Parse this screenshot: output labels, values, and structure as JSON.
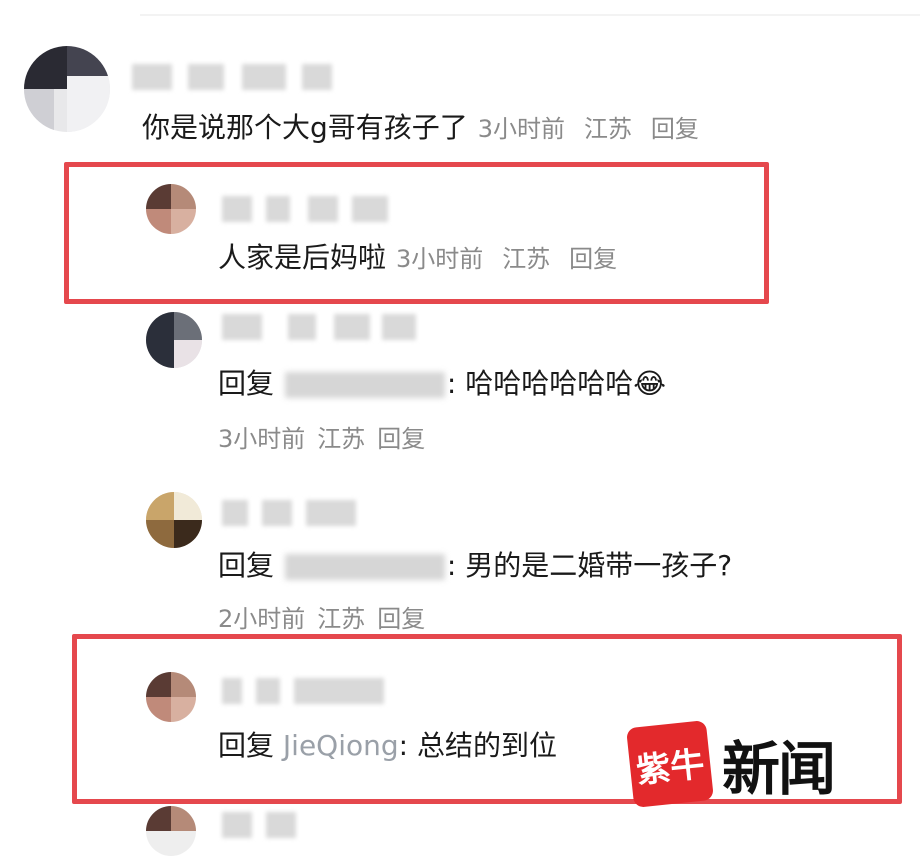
{
  "comments": [
    {
      "id": "c1",
      "text": "你是说那个大g哥有孩子了",
      "meta": {
        "time": "3小时前",
        "location": "江苏",
        "reply": "回复"
      }
    },
    {
      "id": "c2",
      "text": "人家是后妈啦",
      "meta": {
        "time": "3小时前",
        "location": "江苏",
        "reply": "回复"
      }
    },
    {
      "id": "c3",
      "reply_prefix": "回复",
      "text": ": 哈哈哈哈哈哈",
      "emoji": "😂",
      "meta": {
        "time": "3小时前",
        "location": "江苏",
        "reply": "回复"
      }
    },
    {
      "id": "c4",
      "reply_prefix": "回复",
      "text": ": 男的是二婚带一孩子?",
      "meta": {
        "time": "2小时前",
        "location": "江苏",
        "reply": "回复"
      }
    },
    {
      "id": "c5",
      "reply_prefix": "回复",
      "reply_to": "JieQiong",
      "text": ": 总结的到位"
    }
  ],
  "watermark": {
    "logo_text": "紫牛",
    "brand": "新闻"
  },
  "colors": {
    "highlight": "#e5484d",
    "meta": "#8a8a8a",
    "brand_red": "#e3292c"
  }
}
